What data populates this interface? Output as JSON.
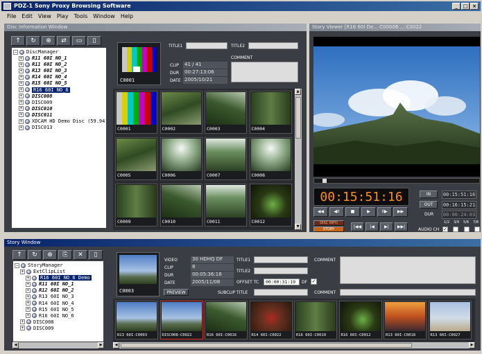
{
  "window": {
    "title": "PDZ-1 Sony Proxy Browsing Software",
    "controls": [
      "_",
      "□",
      "×"
    ]
  },
  "menu": [
    "File",
    "Edit",
    "View",
    "Play",
    "Tools",
    "Window",
    "Help"
  ],
  "disc_info": {
    "title": "Disc Information Window",
    "tree_root": "DiscManager",
    "tree_items": [
      {
        "label": "R11 60I NO_1",
        "style": "bi"
      },
      {
        "label": "R11 60I NO_2",
        "style": "bi"
      },
      {
        "label": "R13 60I NO_3",
        "style": "bi"
      },
      {
        "label": "R14 60I NO_4",
        "style": "bi"
      },
      {
        "label": "R15 60I NO_5",
        "style": "bi"
      },
      {
        "label": "R16 60I NO_6",
        "style": "sel"
      },
      {
        "label": "DISC008",
        "style": "bi"
      },
      {
        "label": "DISC009",
        "style": ""
      },
      {
        "label": "DISC010",
        "style": "bi"
      },
      {
        "label": "DISC011",
        "style": "bi"
      },
      {
        "label": "XDCAM HD Demo Disc (59.94)",
        "style": ""
      },
      {
        "label": "DISC013",
        "style": ""
      }
    ],
    "header": {
      "thumb_label": "C0001",
      "title1_label": "TITLE1",
      "title2_label": "TITLE2",
      "clip_label": "CLIP",
      "clip_value": "41 / 41",
      "dur_label": "DUR",
      "dur_value": "00:27:13:06",
      "date_label": "DATE",
      "date_value": "2005/10/21",
      "comment_label": "COMMENT"
    },
    "thumbs": [
      {
        "label": "C0001",
        "img": "bars"
      },
      {
        "label": "C0002",
        "img": "forest1"
      },
      {
        "label": "C0003",
        "img": "forest2"
      },
      {
        "label": "C0004",
        "img": "forest5"
      },
      {
        "label": "C0005",
        "img": "forest1"
      },
      {
        "label": "C0006",
        "img": "forest4"
      },
      {
        "label": "C0007",
        "img": "forest3"
      },
      {
        "label": "C0008",
        "img": "forest4"
      },
      {
        "label": "C0009",
        "img": "forest5"
      },
      {
        "label": "C0010",
        "img": "forest2"
      },
      {
        "label": "C0011",
        "img": "forest3"
      },
      {
        "label": "C0012",
        "img": "dark1"
      }
    ]
  },
  "viewer": {
    "title": "Story Viewer [R16 60I De... C00006 ... C0022",
    "timecode": "00:15:51:16",
    "in_label": "IN",
    "in_value": "00:15:51:16",
    "out_label": "OUT",
    "out_value": "00:16:15:21",
    "dur_label": "DUR",
    "dur_value": "00:00:24:03",
    "disc_info_btn": "DISC INFO",
    "story_btn": "STORY",
    "audio_label": "AUDIO CH",
    "audio_channels": [
      "1/2",
      "3/4",
      "5/6",
      "7/8"
    ],
    "transport": [
      "◀◀",
      "◀II",
      "■",
      "▶",
      "II▶",
      "▶▶"
    ],
    "transport2": [
      "|◀◀",
      "|◀",
      "▶|",
      "▶▶|"
    ]
  },
  "story": {
    "title": "Story Window",
    "tree_root": "StoryManager",
    "tree_items": [
      {
        "label": "ExtClipList",
        "style": "",
        "indent": 1
      },
      {
        "label": "R16 60I NO_6 Demo",
        "style": "sel",
        "indent": 2
      },
      {
        "label": "R11 60I NO_1",
        "style": "bi",
        "indent": 2
      },
      {
        "label": "R12 60I NO_2",
        "style": "bi",
        "indent": 2
      },
      {
        "label": "R13 60I NO_3",
        "style": "",
        "indent": 2
      },
      {
        "label": "R14 60I NO_4",
        "style": "",
        "indent": 2
      },
      {
        "label": "R15 60I NO_5",
        "style": "",
        "indent": 2
      },
      {
        "label": "R16 60I NO_6",
        "style": "",
        "indent": 2
      },
      {
        "label": "DISC008",
        "style": "",
        "indent": 1
      },
      {
        "label": "DISC009",
        "style": "",
        "indent": 1
      }
    ],
    "header": {
      "thumb_label": "C0003",
      "video_label": "VIDEO",
      "video_value": "30 HDHQ DF",
      "clip_label": "CLIP",
      "clip_value": "8",
      "dur_label": "DUR",
      "dur_value": "00:05:36:18",
      "date_label": "DATE",
      "date_value": "2005/11/08",
      "title1_label": "TITLE1",
      "title2_label": "TITLE2",
      "offset_label": "OFFSET TC",
      "offset_value": "00:00:31:19",
      "df_label": "DF",
      "subclip_label": "SUBCLIP TITLE",
      "comment_label": "COMMENT",
      "comment2_label": "COMMENT",
      "preview_btn": "PREVIEW"
    },
    "clips": [
      {
        "label": "R13 60I-C0003",
        "img": "sky"
      },
      {
        "label": "DISC008-C0022",
        "img": "sky"
      },
      {
        "label": "R16 60I-C0016",
        "img": "forest2"
      },
      {
        "label": "R14 60I-C0022",
        "img": "redfig"
      },
      {
        "label": "R16 60I-C0010",
        "img": "forest5"
      },
      {
        "label": "R16 60I-C0012",
        "img": "dark1"
      },
      {
        "label": "R13 60I-C0018",
        "img": "sunset"
      },
      {
        "label": "R13 60I-C0027",
        "img": "beach"
      }
    ]
  }
}
